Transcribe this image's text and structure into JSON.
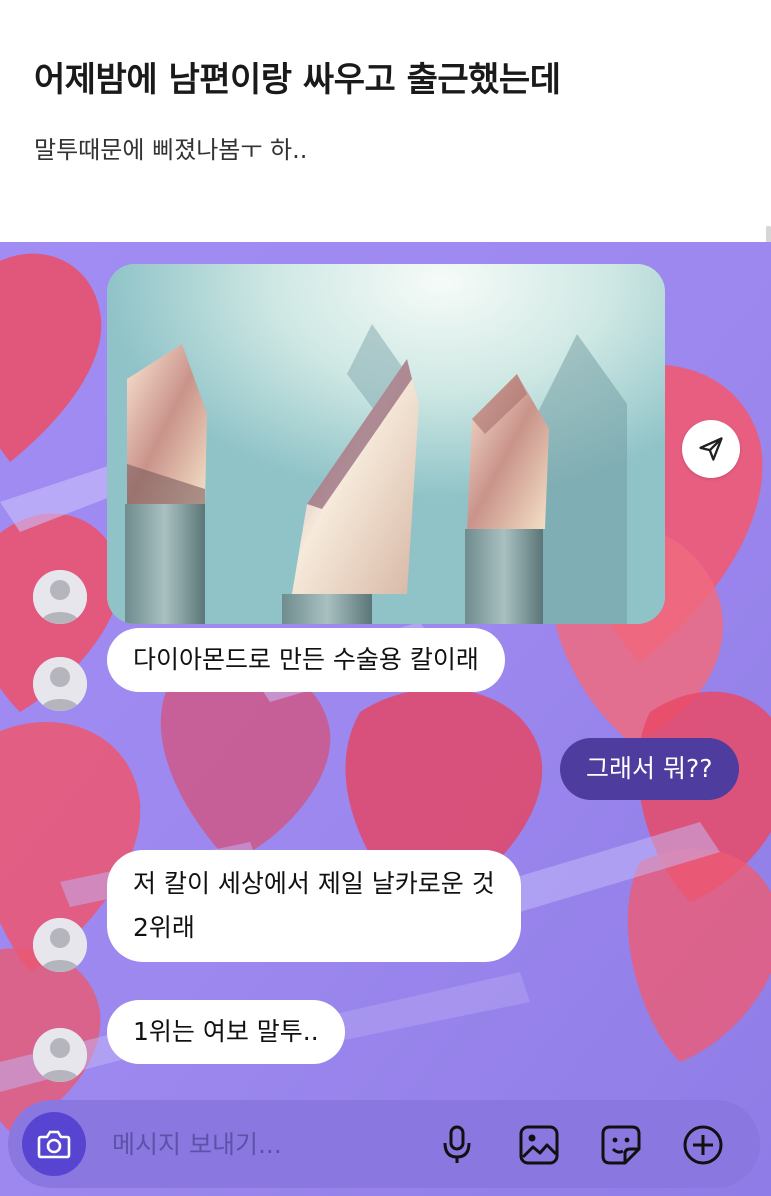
{
  "post": {
    "title": "어제밤에 남편이랑 싸우고 출근했는데",
    "subtitle": "말투때문에 삐졌나봄ㅜ 하.."
  },
  "chat": {
    "messages": [
      {
        "from": "them",
        "text": "다이아몬드로 만든 수술용 칼이래"
      },
      {
        "from": "me",
        "text": "그래서 뭐??"
      },
      {
        "from": "them",
        "lines": [
          "저 칼이 세상에서 제일 날카로운 것",
          "2위래"
        ]
      },
      {
        "from": "them",
        "text": "1위는 여보 말투.."
      }
    ],
    "attachment_icon": "share-send-icon"
  },
  "composer": {
    "placeholder": "메시지 보내기...",
    "icons": [
      "camera-icon",
      "microphone-icon",
      "image-icon",
      "sticker-icon",
      "plus-icon"
    ]
  },
  "colors": {
    "chat_background": "#9a86ee",
    "outgoing_bubble": "#4e3c9e",
    "incoming_bubble": "#ffffff",
    "camera_button": "#5745d1",
    "composer_bar": "#8a78e0"
  }
}
